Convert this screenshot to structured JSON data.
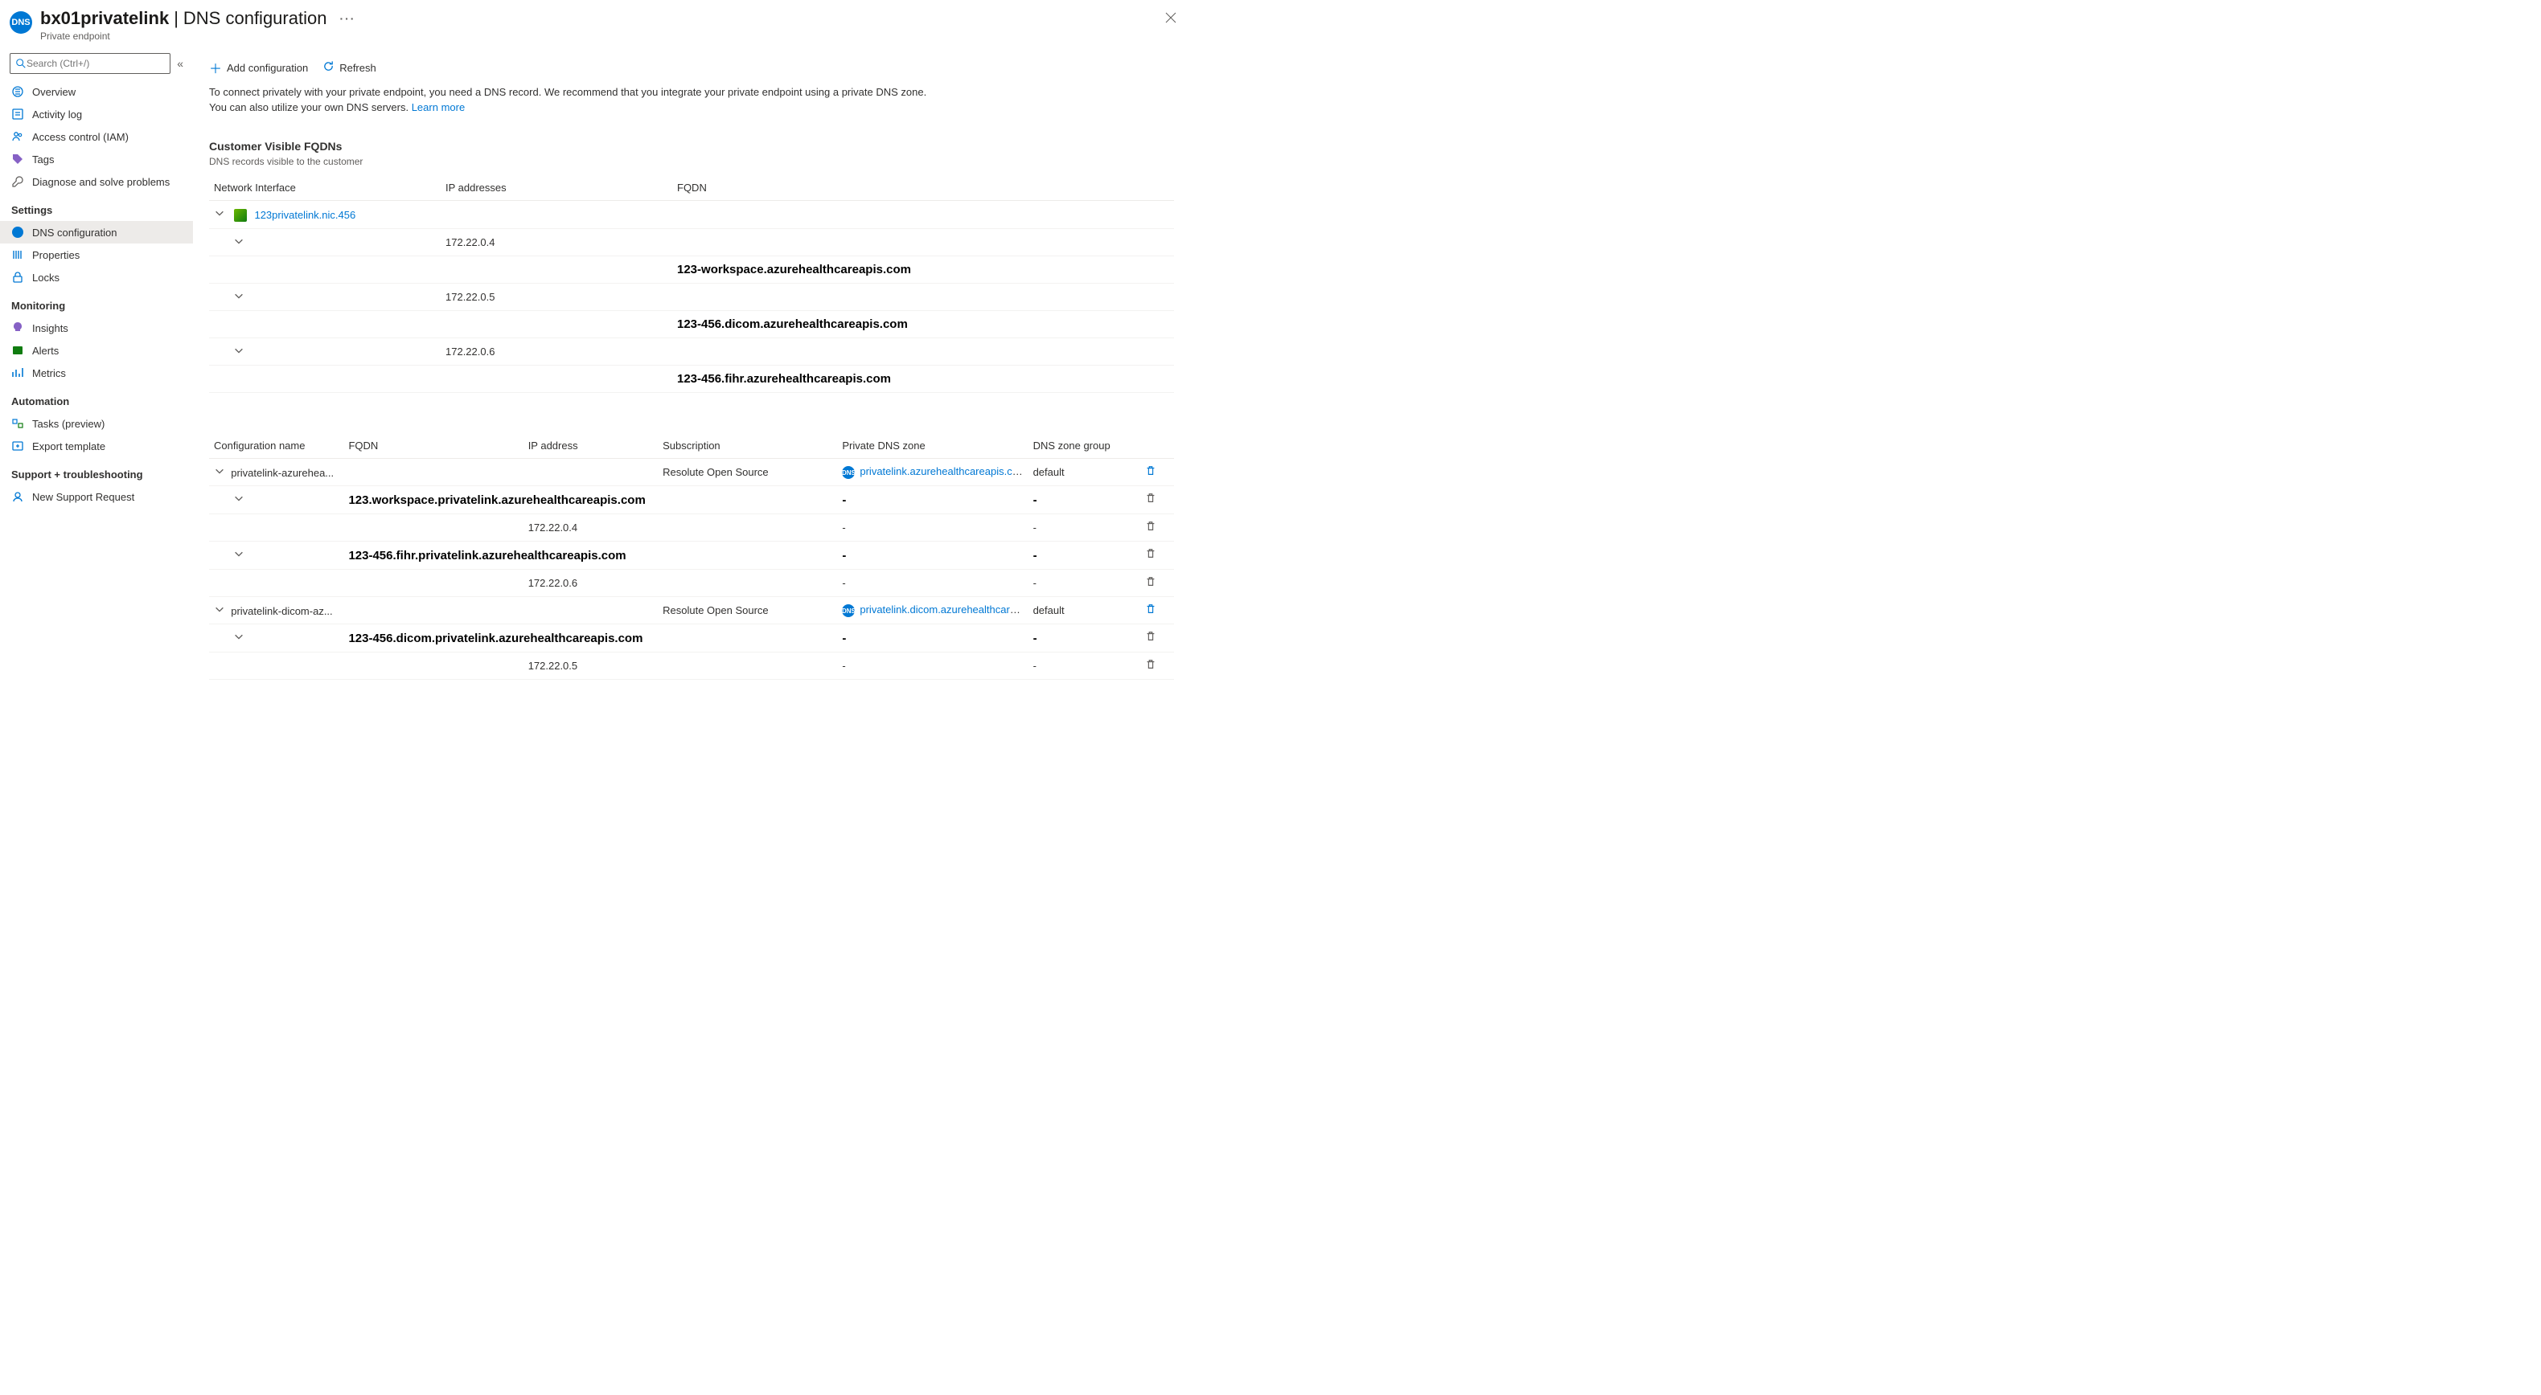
{
  "header": {
    "resource": "bx01privatelink",
    "section": "DNS configuration",
    "subtitle": "Private endpoint"
  },
  "search": {
    "placeholder": "Search (Ctrl+/)"
  },
  "sidebar": {
    "top": [
      {
        "label": "Overview"
      },
      {
        "label": "Activity log"
      },
      {
        "label": "Access control (IAM)"
      },
      {
        "label": "Tags"
      },
      {
        "label": "Diagnose and solve problems"
      }
    ],
    "settings_title": "Settings",
    "settings": [
      {
        "label": "DNS configuration",
        "active": true
      },
      {
        "label": "Properties"
      },
      {
        "label": "Locks"
      }
    ],
    "monitoring_title": "Monitoring",
    "monitoring": [
      {
        "label": "Insights"
      },
      {
        "label": "Alerts"
      },
      {
        "label": "Metrics"
      }
    ],
    "automation_title": "Automation",
    "automation": [
      {
        "label": "Tasks (preview)"
      },
      {
        "label": "Export template"
      }
    ],
    "support_title": "Support + troubleshooting",
    "support": [
      {
        "label": "New Support Request"
      }
    ]
  },
  "toolbar": {
    "add": "Add configuration",
    "refresh": "Refresh"
  },
  "intro": {
    "text": "To connect privately with your private endpoint, you need a DNS record. We recommend that you integrate your private endpoint using a private DNS zone. You can also utilize your own DNS servers. ",
    "learn": "Learn more"
  },
  "fqdns": {
    "title": "Customer Visible FQDNs",
    "subtitle": "DNS records visible to the customer",
    "cols": {
      "nic": "Network Interface",
      "ip": "IP addresses",
      "fqdn": "FQDN"
    },
    "nic_link": "123privatelink.nic.456",
    "rows": [
      {
        "ip": "172.22.0.4",
        "fqdn_bold": "123-workspace.azurehealthcareapis.com"
      },
      {
        "ip": "172.22.0.5",
        "fqdn_bold": "123-456.dicom.azurehealthcareapis.com"
      },
      {
        "ip": "172.22.0.6",
        "fqdn_bold": "123-456.fihr.azurehealthcareapis.com"
      }
    ]
  },
  "config": {
    "cols": {
      "name": "Configuration name",
      "fqdn": "FQDN",
      "ip": "IP address",
      "sub": "Subscription",
      "zone": "Private DNS zone",
      "group": "DNS zone group"
    },
    "groups": [
      {
        "name": "privatelink-azurehea...",
        "sub": "Resolute Open Source",
        "zone": "privatelink.azurehealthcareapis.com",
        "group": "default",
        "rows": [
          {
            "fqdn_bold": "123.workspace.privatelink.azurehealthcareapis.com",
            "ip": "172.22.0.4"
          },
          {
            "fqdn_bold": "123-456.fihr.privatelink.azurehealthcareapis.com",
            "ip": "172.22.0.6"
          }
        ]
      },
      {
        "name": "privatelink-dicom-az...",
        "sub": "Resolute Open Source",
        "zone": "privatelink.dicom.azurehealthcarea...",
        "group": "default",
        "rows": [
          {
            "fqdn_bold": "123-456.dicom.privatelink.azurehealthcareapis.com",
            "ip": "172.22.0.5"
          }
        ]
      }
    ],
    "dash": "-"
  }
}
